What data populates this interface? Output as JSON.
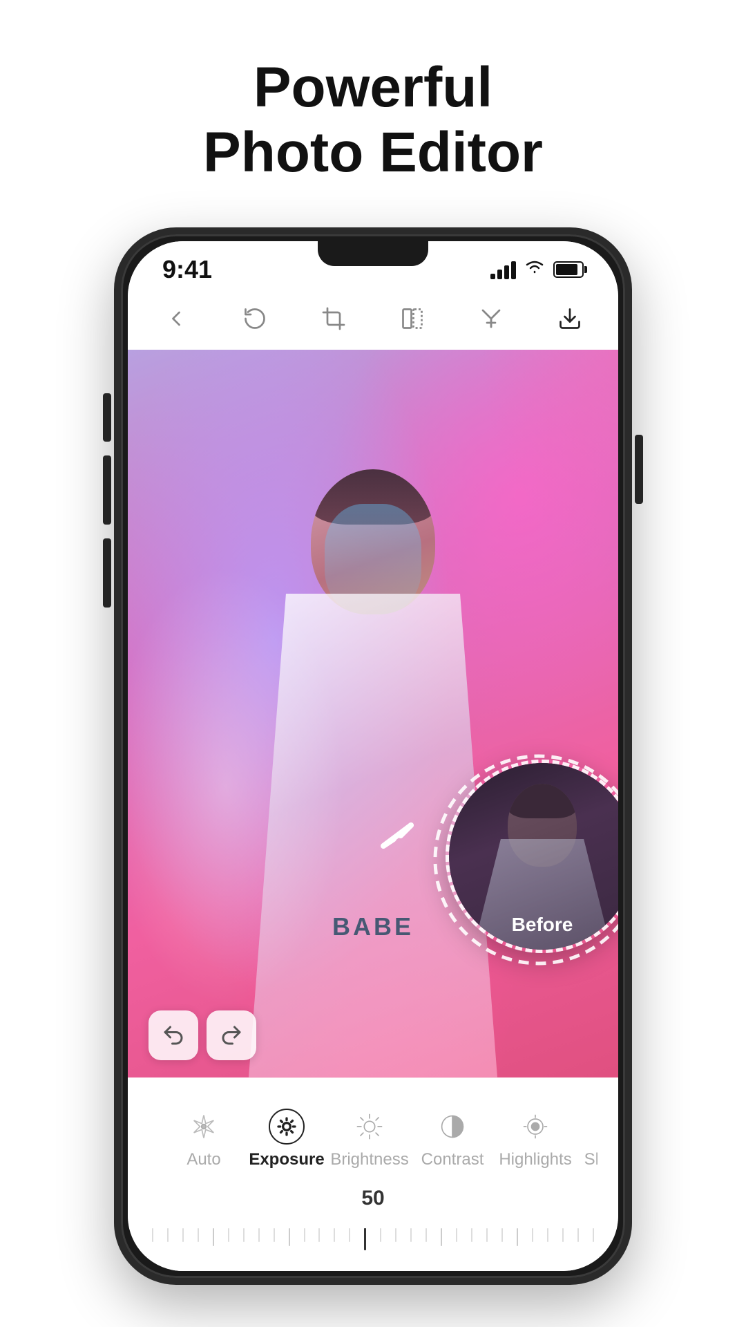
{
  "headline": {
    "line1": "Powerful",
    "line2": "Photo Editor"
  },
  "status_bar": {
    "time": "9:41",
    "signal_bars": [
      8,
      14,
      20,
      26
    ],
    "wifi": "wifi",
    "battery": 85
  },
  "toolbar": {
    "back_label": "back",
    "rotate_label": "rotate",
    "crop_label": "crop",
    "flip_label": "flip",
    "adjust_label": "adjust",
    "download_label": "download"
  },
  "before_label": "Before",
  "undo_label": "undo",
  "redo_label": "redo",
  "tools": [
    {
      "id": "auto",
      "label": "Auto",
      "active": false
    },
    {
      "id": "exposure",
      "label": "Exposure",
      "active": true
    },
    {
      "id": "brightness",
      "label": "Brightness",
      "active": false
    },
    {
      "id": "contrast",
      "label": "Contrast",
      "active": false
    },
    {
      "id": "highlights",
      "label": "Highlights",
      "active": false
    },
    {
      "id": "shadows",
      "label": "Shadows",
      "active": false
    }
  ],
  "slider": {
    "value": "50",
    "min": 0,
    "max": 100,
    "current": 50
  }
}
